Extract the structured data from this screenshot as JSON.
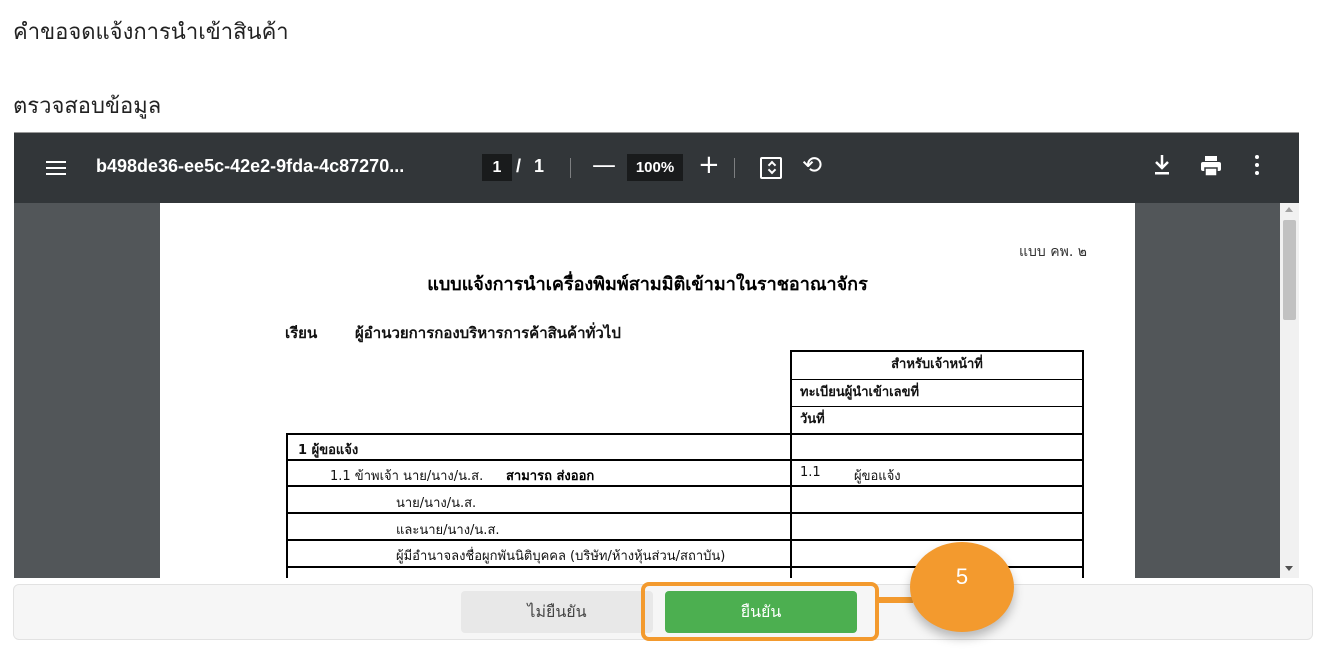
{
  "page": {
    "title": "คำขอจดแจ้งการนำเข้าสินค้า",
    "section_title": "ตรวจสอบข้อมูล"
  },
  "pdf_viewer": {
    "file_name": "b498de36-ee5c-42e2-9fda-4c87270...",
    "current_page": "1",
    "page_separator": "/",
    "total_pages": "1",
    "zoom_out": "—",
    "zoom": "100%",
    "zoom_in": "+",
    "icons": [
      "menu-icon",
      "fit-page-icon",
      "rotate-icon",
      "download-icon",
      "print-icon",
      "more-vert-icon"
    ]
  },
  "document": {
    "form_code": "แบบ คพ. ๒",
    "title": "แบบแจ้งการนำเครื่องพิมพ์สามมิติเข้ามาในราชอาณาจักร",
    "to_label": "เรียน",
    "to_value": "ผู้อำนวยการกองบริหารการค้าสินค้าทั่วไป",
    "officer_box": {
      "header": "สำหรับเจ้าหน้าที่",
      "registration": "ทะเบียนผู้นำเข้าเลขที่",
      "date": "วันที่"
    },
    "section1_title": "1   ผู้ขอแจ้ง",
    "rows": {
      "r1_label": "1.1 ข้าพเจ้า นาย/นาง/น.ส.",
      "r1_value": "สามารถ ส่งออก",
      "r1_right_num": "1.1",
      "r1_right_label": "ผู้ขอแจ้ง",
      "r2_label": "นาย/นาง/น.ส.",
      "r3_label": "และนาย/นาง/น.ส.",
      "r4_label": "ผู้มีอำนาจลงชื่อผูกพันนิติบุคคล (บริษัท/ห้างหุ้นส่วน/สถาบัน)"
    }
  },
  "footer": {
    "reject_label": "ไม่ยืนยัน",
    "confirm_label": "ยืนยัน",
    "confirm_color": "#4caf50"
  },
  "annotation": {
    "step_number": "5",
    "color": "#f39a2e"
  }
}
